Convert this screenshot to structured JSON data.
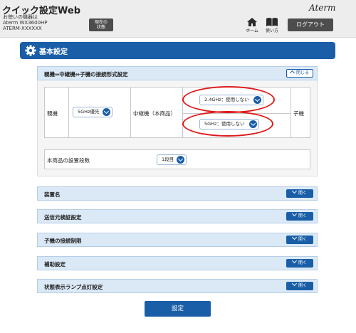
{
  "header": {
    "app_title": "クイック設定Web",
    "device_line1": "お使いの機器は",
    "device_line2": "Aterm WX3600HP",
    "device_line3": "ATERM-XXXXXX",
    "status_button": "現在の\n状態",
    "brand": "Aterm",
    "home_label": "ホーム",
    "help_label": "使い方",
    "logout_label": "ログアウト"
  },
  "section": {
    "title": "基本設定"
  },
  "connection": {
    "title": "親機⇔中継機⇔子機の接続形式設定",
    "close_label": "閉じる",
    "parent_label": "親機",
    "parent_select": "5GHz優先",
    "repeater_label": "中継機（本商品）",
    "band24_select": "2.4GHz：使用しない",
    "band5_select": "5GHz：使用しない",
    "child_label": "子機",
    "stages_label": "本商品の設置段数",
    "stages_select": "1段目"
  },
  "accordions": [
    {
      "title": "装置名",
      "open_label": "開く"
    },
    {
      "title": "送信元検証設定",
      "open_label": "開く"
    },
    {
      "title": "子機の接続制限",
      "open_label": "開く"
    },
    {
      "title": "補助設定",
      "open_label": "開く"
    },
    {
      "title": "状態表示ランプ点灯設定",
      "open_label": "開く"
    }
  ],
  "apply_label": "設定",
  "colors": {
    "primary": "#1a5ea8",
    "accordion_bg": "#dbe9f7",
    "highlight": "#e01818"
  }
}
